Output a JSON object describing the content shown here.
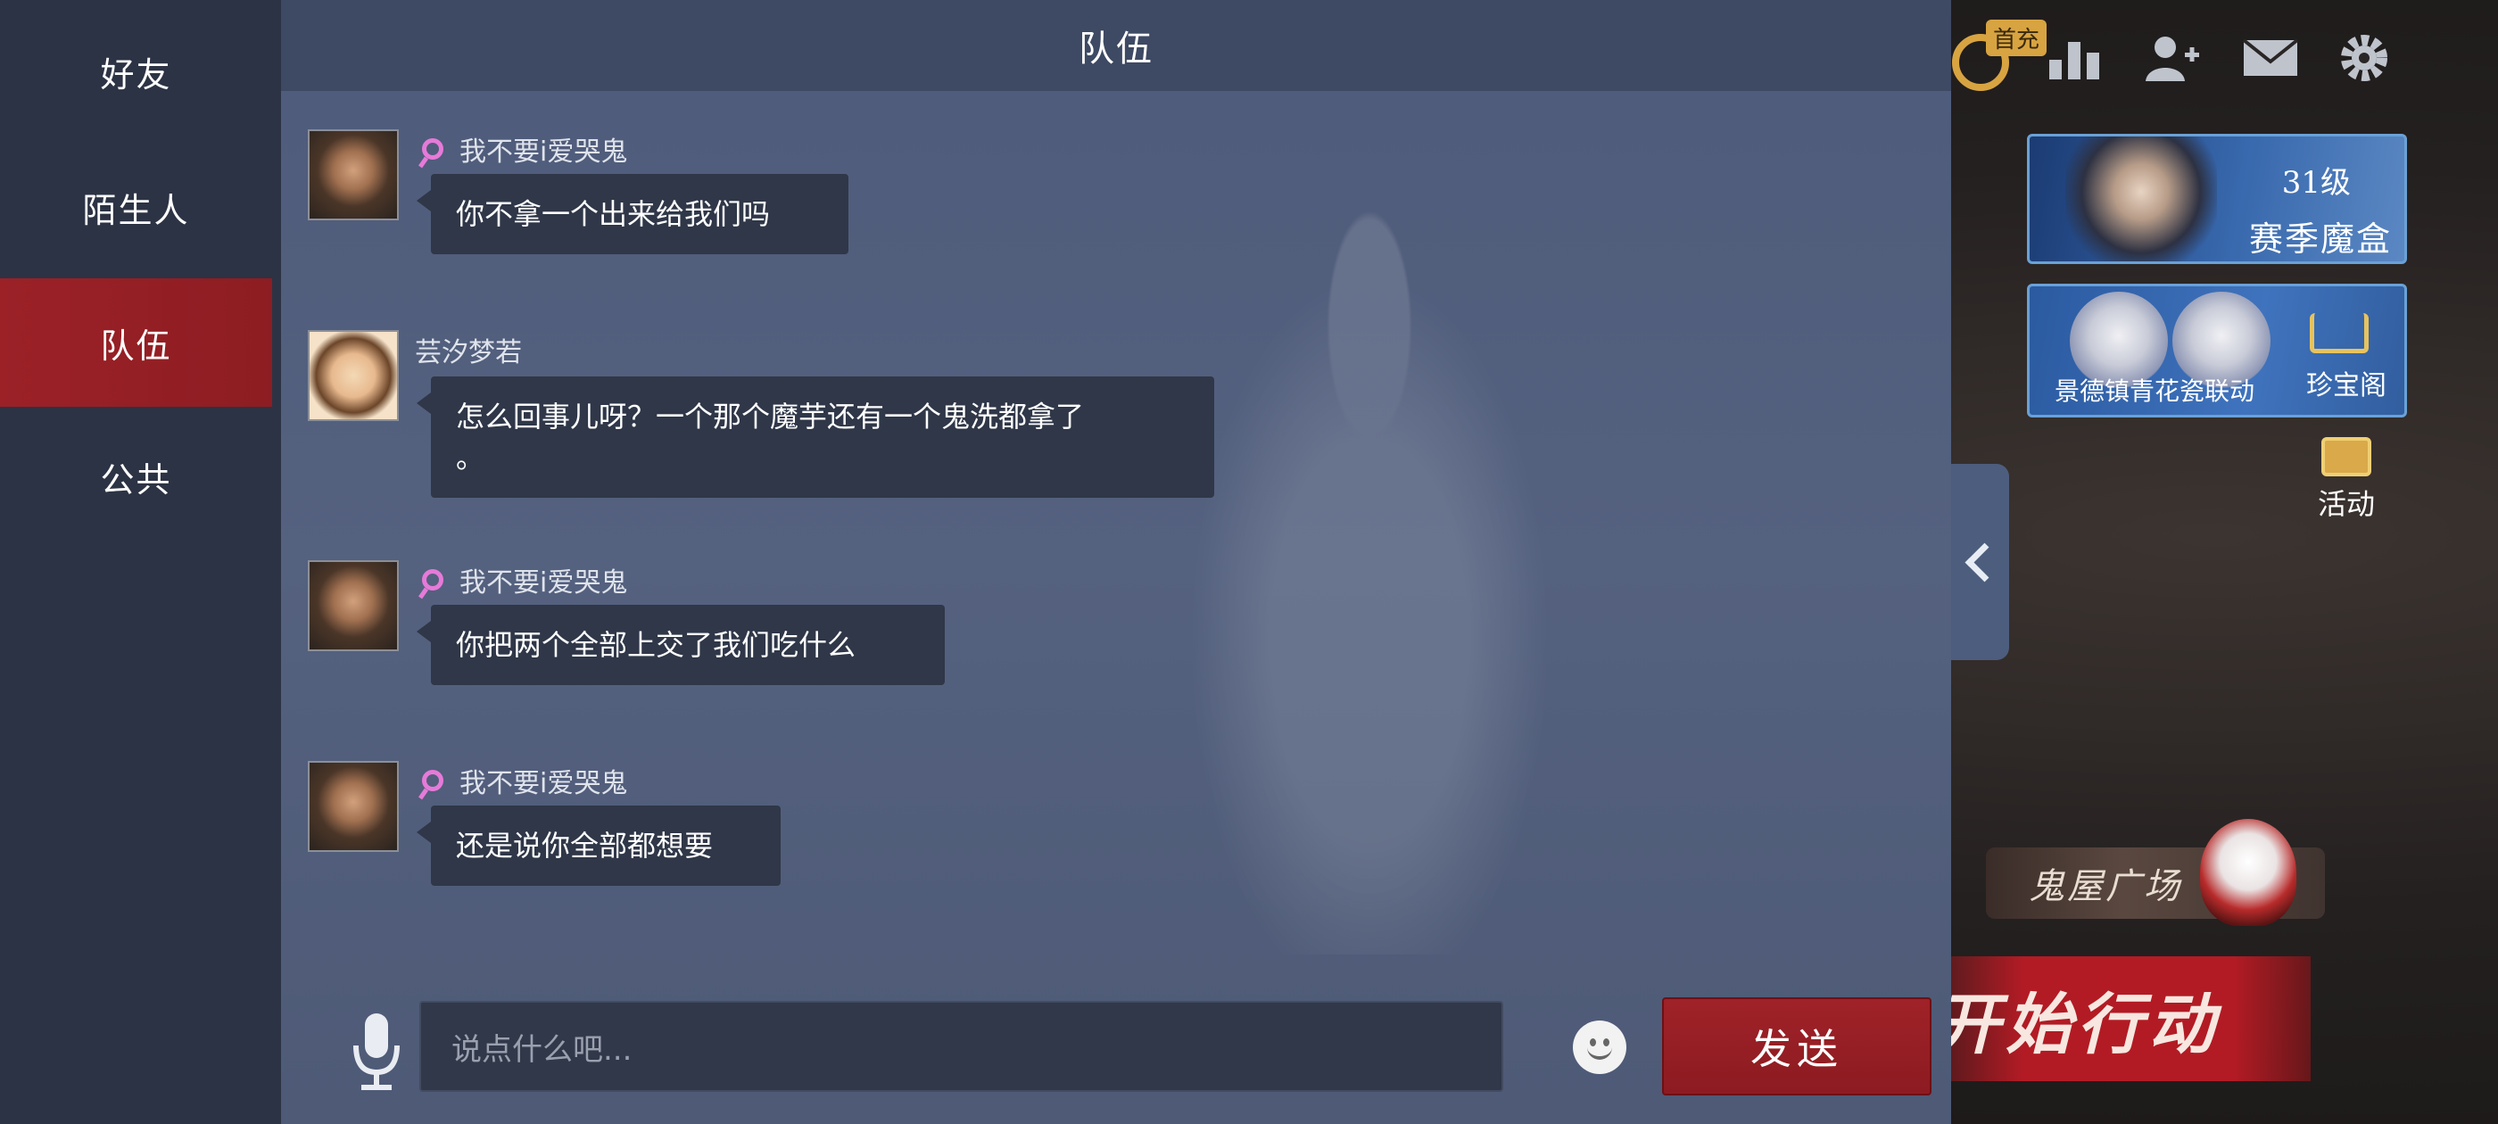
{
  "nav": {
    "items": [
      {
        "label": "好友"
      },
      {
        "label": "陌生人"
      },
      {
        "label": "队伍"
      },
      {
        "label": "公共"
      }
    ],
    "active_index": 2
  },
  "chat": {
    "title": "队伍",
    "messages": [
      {
        "sender": "我不要i爱哭鬼",
        "text": "你不拿一个出来给我们吗"
      },
      {
        "sender": "芸汐梦若",
        "text": "怎么回事儿呀？一个那个魔芋还有一个鬼洗都拿了\n。"
      },
      {
        "sender": "我不要i爱哭鬼",
        "text": "你把两个全部上交了我们吃什么"
      },
      {
        "sender": "我不要i爱哭鬼",
        "text": "还是说你全部都想要"
      }
    ]
  },
  "input": {
    "placeholder": "说点什么吧...",
    "send_label": "发送"
  },
  "game": {
    "first_charge_label": "首充",
    "season": {
      "level": "31级",
      "title": "赛季魔盒"
    },
    "collab": {
      "title": "景德镇青花瓷联动",
      "treasure_label": "珍宝阁"
    },
    "activity_label": "活动",
    "plaza_label": "鬼屋广场",
    "start_label": "开始行动"
  }
}
